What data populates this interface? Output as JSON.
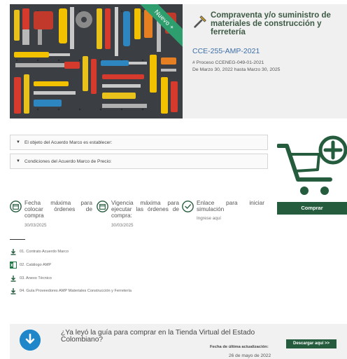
{
  "hero": {
    "badge": "Nuevo +",
    "title": "Compraventa y/o suministro de materiales de construcción y ferretería",
    "code": "CCE-255-AMP-2021",
    "process": "# Proceso CCENEG-049-01-2021",
    "dates": "De Marzo 30, 2022 hasta Marzo 30, 2025"
  },
  "accordions": [
    "El objeto del Acuerdo Marco es establecer:",
    "Condiciones del Acuerdo Marco de Precio:"
  ],
  "buy_label": "Comprar",
  "info": [
    {
      "icon": "calendar-icon",
      "text": "Fecha máxima para colocar órdenes de compra",
      "value": "30/03/2025"
    },
    {
      "icon": "calendar-icon",
      "text": "Vigencia máxima para ejecutar las órdenes de compra:",
      "value": "30/03/2025"
    },
    {
      "icon": "check-circle-icon",
      "text": "Enlace para iniciar simulación",
      "value": "Ingrese aquí"
    }
  ],
  "documents": [
    {
      "icon": "download-icon",
      "label": "01. Contrato Acuerdo Marco"
    },
    {
      "icon": "excel-icon",
      "label": "02. Catálogo AMP"
    },
    {
      "icon": "download-icon",
      "label": "03. Anexo Técnico"
    },
    {
      "icon": "download-icon",
      "label": "04. Guía Proveedores AMP Materiales Construcción y Ferretería"
    }
  ],
  "banner": {
    "question": "¿Ya leyó la guía para comprar en la Tienda Virtual del Estado Colombiano?",
    "date_label": "Fecha de última actualización:",
    "date": "26 de mayo de 2022",
    "download_label": "Descargar aquí >>"
  },
  "colors": {
    "primary_green": "#245c3d",
    "accent_green": "#2f9e6e",
    "link_blue": "#3c6ea8",
    "banner_blue": "#1e86c9"
  }
}
